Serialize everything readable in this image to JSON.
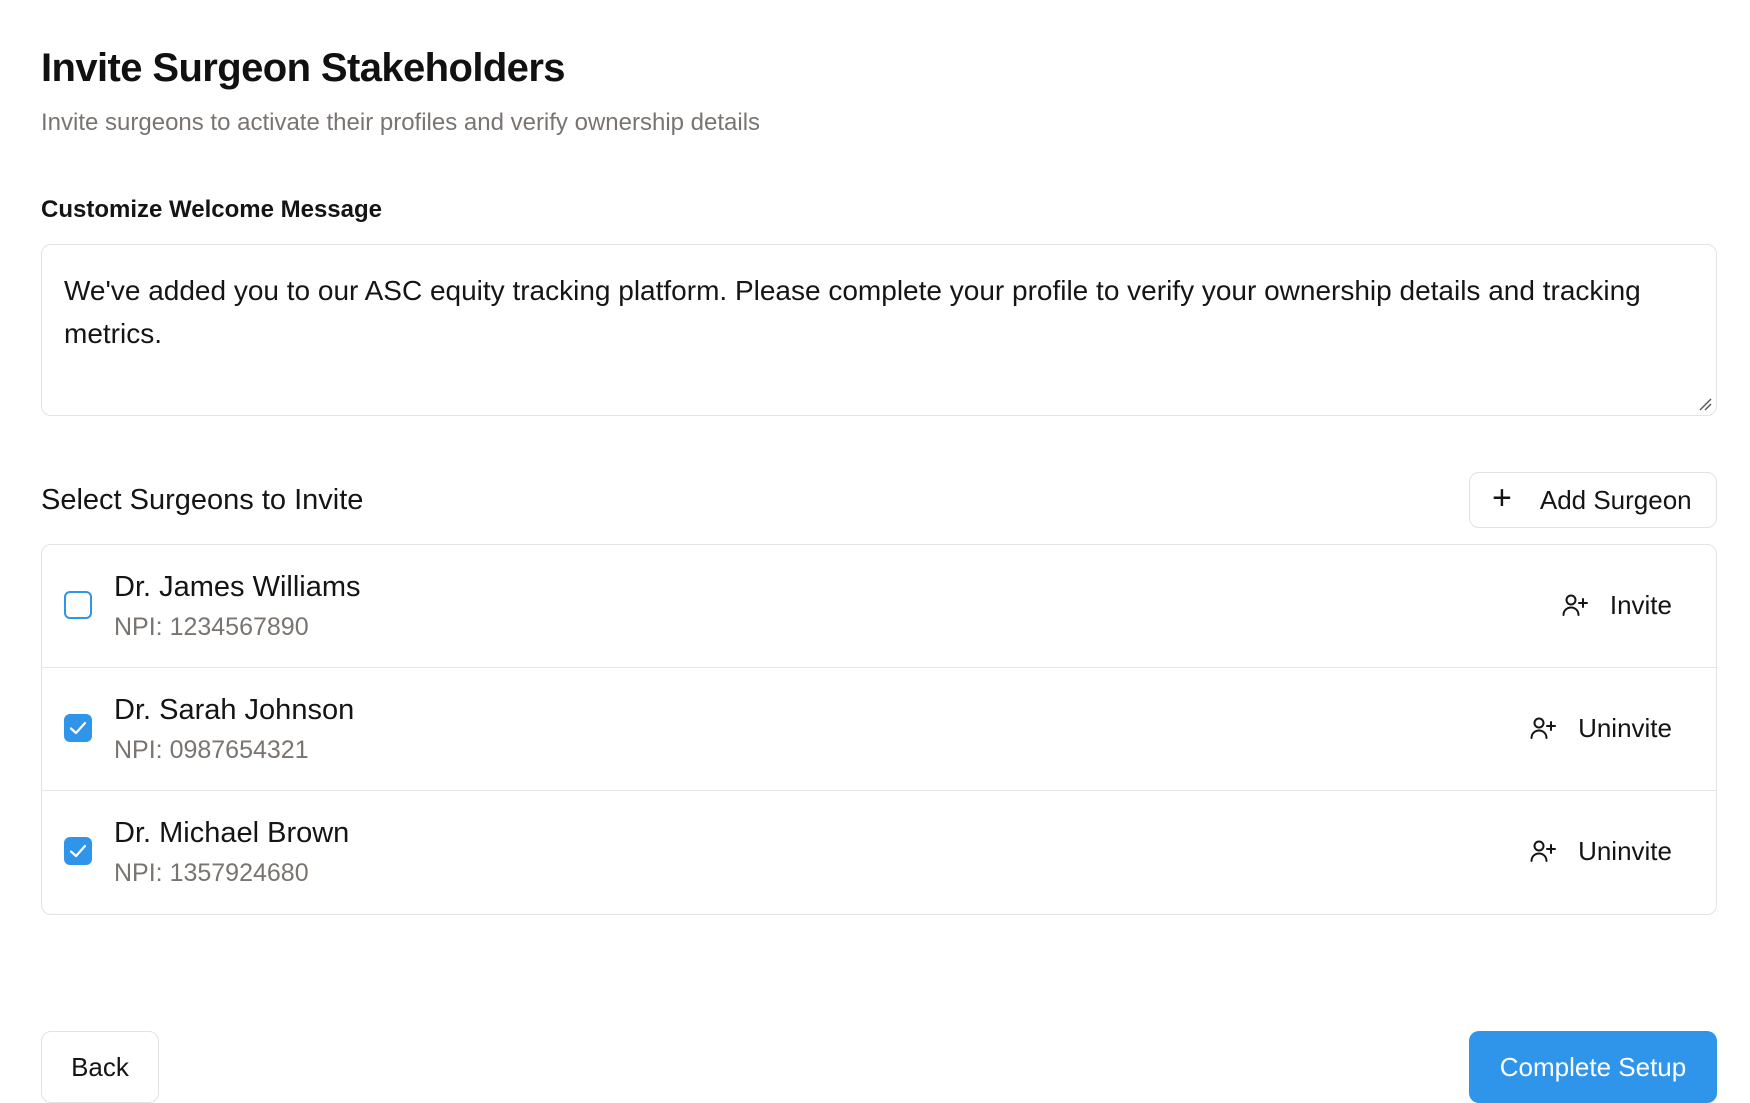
{
  "header": {
    "title": "Invite Surgeon Stakeholders",
    "subtitle": "Invite surgeons to activate their profiles and verify ownership details"
  },
  "welcome": {
    "label": "Customize Welcome Message",
    "message": "We've added you to our ASC equity tracking platform. Please complete your profile to verify your ownership details and tracking metrics."
  },
  "surgeons_section": {
    "title": "Select Surgeons to Invite",
    "add_button_label": "Add Surgeon",
    "add_icon": "plus-icon",
    "rows": [
      {
        "name": "Dr. James Williams",
        "npi": "NPI: 1234567890",
        "checked": false,
        "action_label": "Invite",
        "action_icon": "user-plus-icon"
      },
      {
        "name": "Dr. Sarah Johnson",
        "npi": "NPI: 0987654321",
        "checked": true,
        "action_label": "Uninvite",
        "action_icon": "user-plus-icon"
      },
      {
        "name": "Dr. Michael Brown",
        "npi": "NPI: 1357924680",
        "checked": true,
        "action_label": "Uninvite",
        "action_icon": "user-plus-icon"
      }
    ]
  },
  "footer": {
    "back_label": "Back",
    "complete_label": "Complete Setup"
  },
  "colors": {
    "accent": "#2f95ea",
    "muted_text": "#7a7470",
    "border": "#e3e3e3"
  }
}
